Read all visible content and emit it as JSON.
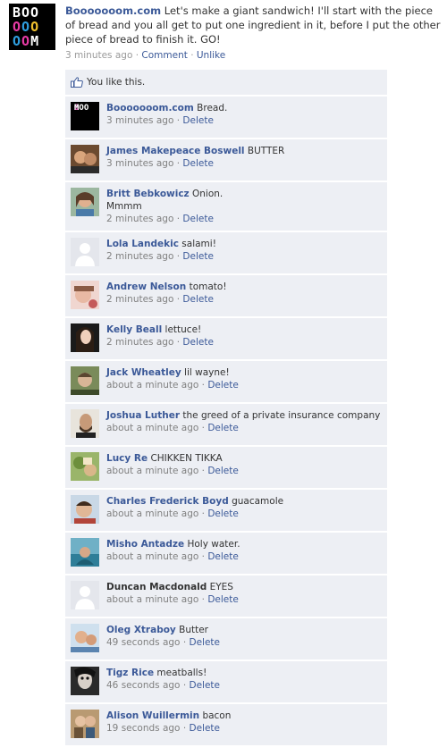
{
  "post": {
    "author": "Booooooom.com",
    "text": "Let's make a giant sandwich! I'll start with the piece of bread and you all get to put one ingredient in it, before I put the other piece of bread to finish it. GO!",
    "time": "3 minutes ago",
    "comment_label": "Comment",
    "unlike_label": "Unlike",
    "sep": " · "
  },
  "likes": {
    "text": "You like this."
  },
  "comments": [
    {
      "name": "Booooooom.com",
      "text": "Bread.",
      "time": "3 minutes ago",
      "delete": "Delete"
    },
    {
      "name": "James Makepeace Boswell",
      "text": "BUTTER",
      "time": "3 minutes ago",
      "delete": "Delete"
    },
    {
      "name": "Britt Bebkowicz",
      "text": "Onion.",
      "text2": "Mmmm",
      "time": "2 minutes ago",
      "delete": "Delete"
    },
    {
      "name": "Lola Landekic",
      "text": "salami!",
      "time": "2 minutes ago",
      "delete": "Delete"
    },
    {
      "name": "Andrew Nelson",
      "text": "tomato!",
      "time": "2 minutes ago",
      "delete": "Delete"
    },
    {
      "name": "Kelly Beall",
      "text": "lettuce!",
      "time": "2 minutes ago",
      "delete": "Delete"
    },
    {
      "name": "Jack Wheatley",
      "text": "lil wayne!",
      "time": "about a minute ago",
      "delete": "Delete"
    },
    {
      "name": "Joshua Luther",
      "text": "the greed of a private insurance company",
      "time": "about a minute ago",
      "delete": "Delete"
    },
    {
      "name": "Lucy Re",
      "text": "CHIKKEN TIKKA",
      "time": "about a minute ago",
      "delete": "Delete"
    },
    {
      "name": "Charles Frederick Boyd",
      "text": "guacamole",
      "time": "about a minute ago",
      "delete": "Delete"
    },
    {
      "name": "Misho Antadze",
      "text": "Holy water.",
      "time": "about a minute ago",
      "delete": "Delete"
    },
    {
      "name": "Duncan Macdonald",
      "text": "EYES",
      "time": "about a minute ago",
      "delete": "Delete"
    },
    {
      "name": "Oleg Xtraboy",
      "text": "Butter",
      "time": "49 seconds ago",
      "delete": "Delete"
    },
    {
      "name": "Tigz Rice",
      "text": "meatballs!",
      "time": "46 seconds ago",
      "delete": "Delete"
    },
    {
      "name": "Alison Wuillermin",
      "text": "bacon",
      "time": "19 seconds ago",
      "delete": "Delete"
    }
  ],
  "logo": {
    "row1": "BOO",
    "row2": "OOO",
    "row3": "OOM"
  },
  "colors": {
    "link": "#3b5998",
    "comment_bg": "#edeff4",
    "logo_b": "#ffffff",
    "logo_o1": "#e93ba6",
    "logo_o2": "#2f9fe0",
    "logo_o3": "#f2c12e"
  }
}
